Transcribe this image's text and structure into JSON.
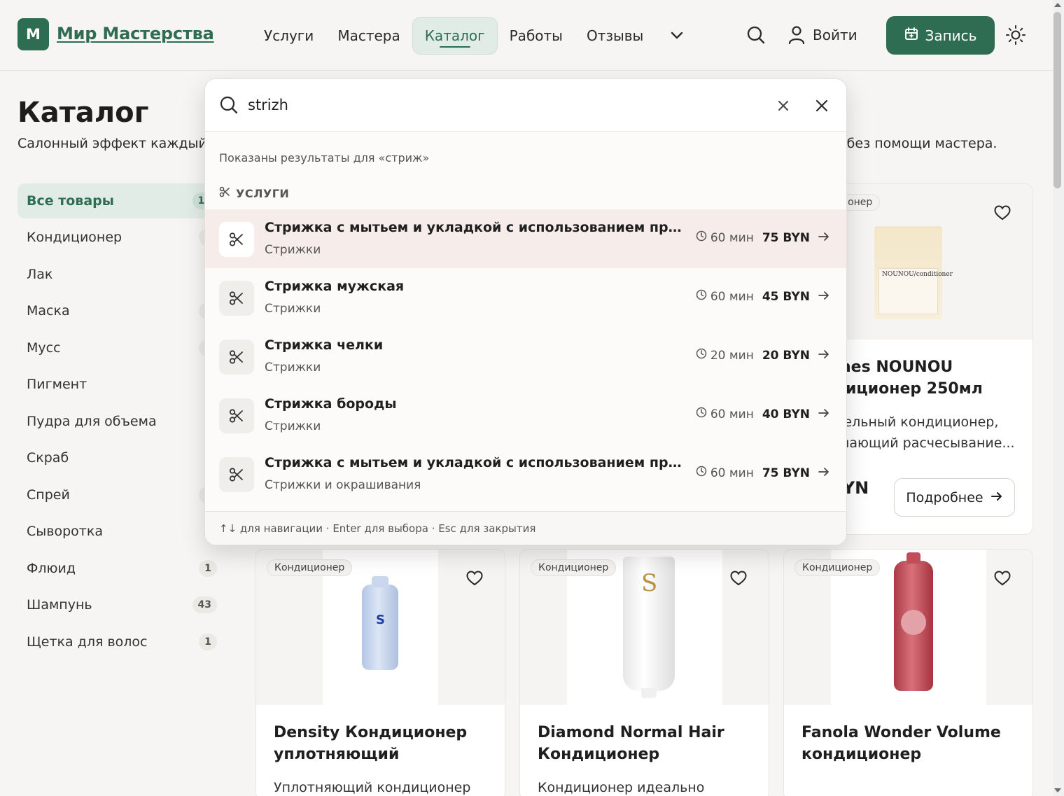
{
  "header": {
    "logo_letter": "М",
    "logo_text": "Мир Мастерства",
    "nav": [
      {
        "label": "Услуги"
      },
      {
        "label": "Мастера"
      },
      {
        "label": "Каталог"
      },
      {
        "label": "Работы"
      },
      {
        "label": "Отзывы"
      }
    ],
    "login_label": "Войти",
    "book_label": "Запись"
  },
  "page": {
    "title": "Каталог",
    "subtitle": "Салонный эффект каждый день. Топовые маски, спреи и стайлинги, чтобы ваши волосы выглядели ухоженно даже без помощи мастера."
  },
  "sidebar": {
    "items": [
      {
        "label": "Все товары",
        "count": "10"
      },
      {
        "label": "Кондиционер",
        "count": "1"
      },
      {
        "label": "Лак",
        "count": ""
      },
      {
        "label": "Маска",
        "count": "2"
      },
      {
        "label": "Мусс",
        "count": "1"
      },
      {
        "label": "Пигмент",
        "count": ""
      },
      {
        "label": "Пудра для объема",
        "count": ""
      },
      {
        "label": "Скраб",
        "count": ""
      },
      {
        "label": "Спрей",
        "count": "1"
      },
      {
        "label": "Сыворотка",
        "count": ""
      },
      {
        "label": "Флюид",
        "count": "1"
      },
      {
        "label": "Шампунь",
        "count": "43"
      },
      {
        "label": "Щетка для волос",
        "count": "1"
      }
    ]
  },
  "products": [
    {
      "badge": "Кондиционер",
      "title": "Davines NOUNOU кондиционер 250мл",
      "desc": "Питательный кондиционер, облегчающий расчесывание...",
      "price": "90 BYN",
      "more": "Подробнее",
      "label_text": "NOUNOU/conditioner"
    },
    {
      "badge": "Кондиционер",
      "title": "Density Кондиционер уплотняющий",
      "desc": "Уплотняющий кондиционер",
      "price": "",
      "more": "Подробнее",
      "label_text": "S"
    },
    {
      "badge": "Кондиционер",
      "title": "Diamond Normal Hair Кондиционер",
      "desc": "Кондиционер идеально",
      "price": "",
      "more": "Подробнее",
      "label_text": "S"
    },
    {
      "badge": "Кондиционер",
      "title": "Fanola Wonder Volume кондиционер",
      "desc": "",
      "price": "",
      "more": "Подробнее",
      "label_text": ""
    }
  ],
  "search": {
    "query": "strizh",
    "note": "Показаны результаты для «стриж»",
    "section_label": "УСЛУГИ",
    "results": [
      {
        "title": "Стрижка с мытьем и укладкой с использованием препаратов",
        "category": "Стрижки",
        "time": "60 мин",
        "price": "75 BYN"
      },
      {
        "title": "Стрижка мужская",
        "category": "Стрижки",
        "time": "60 мин",
        "price": "45 BYN"
      },
      {
        "title": "Стрижка челки",
        "category": "Стрижки",
        "time": "20 мин",
        "price": "20 BYN"
      },
      {
        "title": "Стрижка бороды",
        "category": "Стрижки",
        "time": "60 мин",
        "price": "40 BYN"
      },
      {
        "title": "Стрижка с мытьем и укладкой с использованием препаратов",
        "category": "Стрижки и окрашивания",
        "time": "60 мин",
        "price": "75 BYN"
      }
    ],
    "footer": "↑↓ для навигации · Enter для выбора · Esc для закрытия"
  },
  "colors": {
    "brand": "#2f6d52",
    "brand_light": "#e2ece6",
    "active_row": "#f6ece9"
  }
}
